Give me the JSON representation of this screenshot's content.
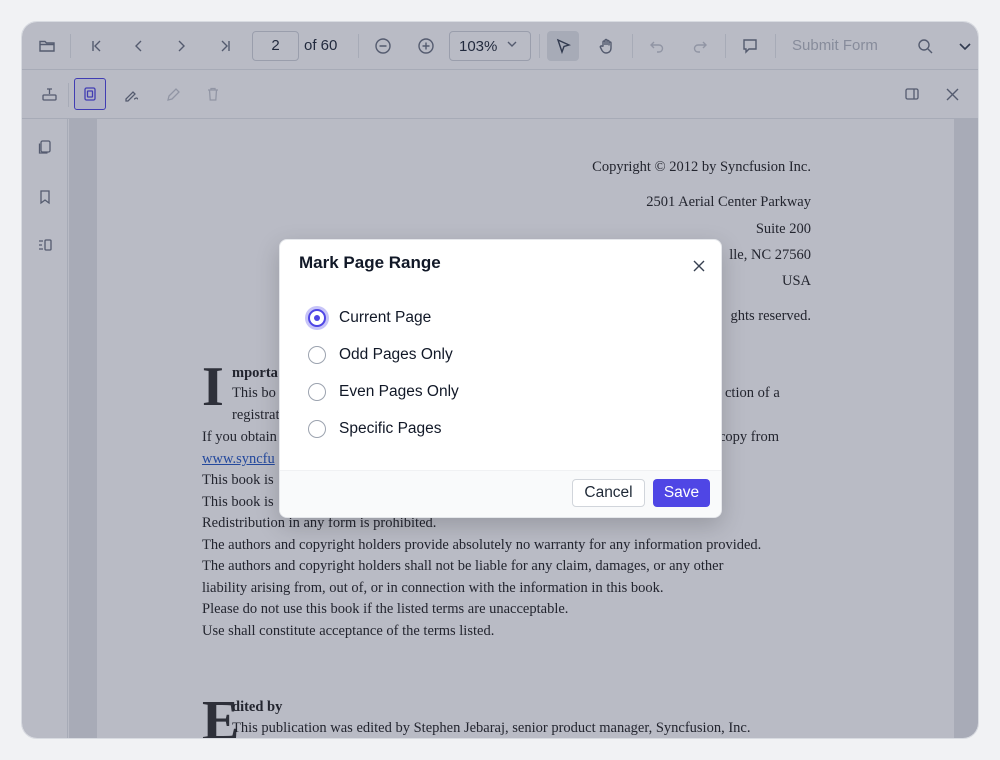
{
  "toolbar": {
    "page_number": "2",
    "page_count_label": "of 60",
    "zoom_label": "103%",
    "submit_form_label": "Submit Form",
    "icons": [
      "folder-open-icon",
      "first-page-icon",
      "previous-page-icon",
      "next-page-icon",
      "last-page-icon",
      "zoom-out-icon",
      "zoom-in-icon",
      "chevron-down-icon",
      "selection-pointer-icon",
      "pan-hand-icon",
      "undo-icon",
      "redo-icon",
      "comment-icon",
      "search-icon",
      "more-chevron-icon"
    ]
  },
  "secondary_toolbar": {
    "icons": [
      "form-designer-icon",
      "page-range-icon",
      "signature-icon",
      "edit-pen-icon",
      "delete-icon",
      "panel-toggle-icon",
      "close-icon"
    ]
  },
  "left_nav": {
    "icons": [
      "page-thumbnails-icon",
      "bookmark-icon",
      "organize-pages-icon"
    ]
  },
  "document": {
    "right_block": [
      "Copyright © 2012 by Syncfusion Inc.",
      "2501 Aerial Center Parkway",
      "Suite 200",
      "lle, NC 27560",
      "USA",
      "ghts reserved."
    ],
    "important": {
      "dropcap": "I",
      "heading": "mporta",
      "line1_left": "This bo",
      "line1_right": "ction of a",
      "line2_left": "registrat"
    },
    "body_left": [
      "If you obtain",
      "This book is",
      "This book is"
    ],
    "copy_from": "copy from",
    "link_text": "www.syncfu",
    "body_lines": [
      "Redistribution in any form is prohibited.",
      "The authors and copyright holders provide absolutely no warranty for any information provided.",
      "The authors and copyright holders shall not be liable for any claim, damages, or any other",
      "liability arising from, out of, or in connection with the information in this book.",
      "Please do not use this book if the listed terms are unacceptable.",
      "Use shall constitute acceptance of the terms listed."
    ],
    "edited": {
      "dropcap": "E",
      "heading": "dited by",
      "line": "This publication was edited by Stephen Jebaraj, senior product manager, Syncfusion, Inc."
    }
  },
  "dialog": {
    "title": "Mark Page Range",
    "options": [
      {
        "label": "Current Page",
        "checked": true
      },
      {
        "label": "Odd Pages Only",
        "checked": false
      },
      {
        "label": "Even Pages Only",
        "checked": false
      },
      {
        "label": "Specific Pages",
        "checked": false
      }
    ],
    "cancel_label": "Cancel",
    "save_label": "Save"
  },
  "colors": {
    "accent": "#4f46e5",
    "overlay": "#242c4a",
    "link": "#2457c5"
  }
}
